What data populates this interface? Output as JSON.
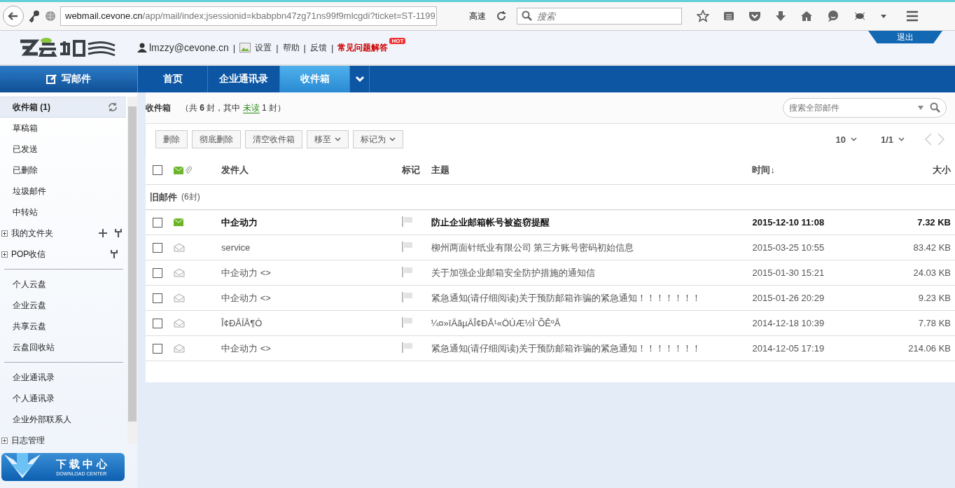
{
  "browser": {
    "url_host": "webmail.cevone.cn",
    "url_path": "/app/mail/index;jsessionid=kbabpbn47zg71ns99f9mlcgdi?ticket=ST-1199",
    "speed_label": "高速",
    "search_placeholder": "搜索"
  },
  "header": {
    "user": "lmzzy@cevone.cn",
    "links": [
      {
        "label": "设置",
        "kind": "normal"
      },
      {
        "label": "帮助",
        "kind": "normal"
      },
      {
        "label": "反馈",
        "kind": "normal"
      },
      {
        "label": "常见问题解答",
        "kind": "hot"
      }
    ],
    "hot_badge": "HOT",
    "separator": "|",
    "logout": "退出"
  },
  "compose": "写邮件",
  "tabs": [
    {
      "label": "首页",
      "selected": false
    },
    {
      "label": "企业通讯录",
      "selected": false
    },
    {
      "label": "收件箱",
      "selected": true
    }
  ],
  "sidebar": {
    "groups": [
      [
        {
          "label": "收件箱 (1)",
          "kind": "current",
          "selected": true
        },
        {
          "label": "草稿箱",
          "kind": "plain",
          "selected": false
        },
        {
          "label": "已发送",
          "kind": "plain",
          "selected": false
        },
        {
          "label": "已删除",
          "kind": "plain",
          "selected": false
        },
        {
          "label": "垃圾邮件",
          "kind": "plain",
          "selected": false
        },
        {
          "label": "中转站",
          "kind": "plain",
          "selected": false
        },
        {
          "label": "我的文件夹",
          "kind": "folder-add",
          "selected": false
        },
        {
          "label": "POP收信",
          "kind": "folder",
          "selected": false
        }
      ],
      [
        {
          "label": "个人云盘",
          "kind": "plain",
          "selected": false
        },
        {
          "label": "企业云盘",
          "kind": "plain",
          "selected": false
        },
        {
          "label": "共享云盘",
          "kind": "plain",
          "selected": false
        },
        {
          "label": "云盘回收站",
          "kind": "plain",
          "selected": false
        }
      ],
      [
        {
          "label": "企业通讯录",
          "kind": "plain",
          "selected": false
        },
        {
          "label": "个人通讯录",
          "kind": "plain",
          "selected": false
        },
        {
          "label": "企业外部联系人",
          "kind": "plain",
          "selected": false
        },
        {
          "label": "日志管理",
          "kind": "folder",
          "selected": false
        }
      ]
    ],
    "download_title": "下 载 中 心",
    "download_sub": "DOWNLOAD CENTER"
  },
  "mailbox": {
    "title": "收件箱",
    "summary_pre": "（共",
    "total": "6",
    "summary_mid": "封，其中",
    "unread_link": "未读",
    "unread": "1 封）",
    "search_placeholder": "搜索全部邮件"
  },
  "actions": [
    {
      "label": "删除",
      "kind": "plain"
    },
    {
      "label": "彻底删除",
      "kind": "plain"
    },
    {
      "label": "清空收件箱",
      "kind": "plain"
    },
    {
      "label": "移至",
      "kind": "menu"
    },
    {
      "label": "标记为",
      "kind": "menu"
    }
  ],
  "pager": {
    "per_page": "10",
    "page": "1/1"
  },
  "table": {
    "select_all_checked": false,
    "columns": [
      "发件人",
      "标记",
      "主题",
      "时间↓",
      "大小"
    ],
    "group": "旧邮件",
    "group_count": "(6封)",
    "rows": [
      {
        "sender": "中企动力",
        "subject": "防止企业邮箱帐号被盗窃提醒",
        "time": "2015-12-10 11:08",
        "size": "7.32 KB",
        "unread": true,
        "checked": false
      },
      {
        "sender": "service",
        "subject": "柳州两面针纸业有限公司 第三方账号密码初始信息",
        "time": "2015-03-25 10:55",
        "size": "83.42 KB",
        "unread": false,
        "checked": false
      },
      {
        "sender": "中企动力 <>",
        "subject": "关于加强企业邮箱安全防护措施的通知信",
        "time": "2015-01-30 15:21",
        "size": "24.03 KB",
        "unread": false,
        "checked": false
      },
      {
        "sender": "中企动力 <>",
        "subject": "紧急通知(请仔细阅读)关于预防邮箱诈骗的紧急通知！！！！！！！",
        "time": "2015-01-26 20:29",
        "size": "9.23 KB",
        "unread": false,
        "checked": false
      },
      {
        "sender": "Î¢ÐÅÍÅ¶Ó",
        "subject": "¼¤»îÄãµÄÎ¢ÐÅ¹«ÖÚÆ½Ì¨ÕÊºÅ",
        "time": "2014-12-18 10:39",
        "size": "7.78 KB",
        "unread": false,
        "checked": false
      },
      {
        "sender": "中企动力 <>",
        "subject": "紧急通知(请仔细阅读)关于预防邮箱诈骗的紧急通知！！！！！！！",
        "time": "2014-12-05 17:19",
        "size": "214.06 KB",
        "unread": false,
        "checked": false
      }
    ]
  }
}
